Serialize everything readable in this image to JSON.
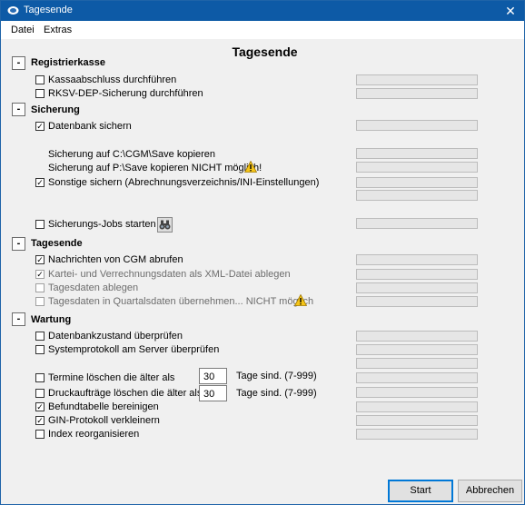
{
  "window": {
    "title": "Tagesende",
    "close_glyph": "✕",
    "app_icon": "cgm-app-icon"
  },
  "menu": {
    "items": [
      "Datei",
      "Extras"
    ]
  },
  "page": {
    "title": "Tagesende"
  },
  "icons": {
    "collapse_glyph": "-",
    "check_glyph": "✓",
    "warning_icon": "warning-triangle-icon",
    "find_icon": "binoculars-icon"
  },
  "sections": {
    "registrierkasse": {
      "title": "Registrierkasse",
      "items": [
        "Kassaabschluss durchführen",
        "RKSV-DEP-Sicherung durchführen"
      ]
    },
    "sicherung": {
      "title": "Sicherung",
      "datenbank": "Datenbank sichern",
      "copy_c": "Sicherung auf C:\\CGM\\Save kopieren",
      "copy_p": "Sicherung auf P:\\Save kopieren NICHT möglich!",
      "sonstige": "Sonstige sichern (Abrechnungsverzeichnis/INI-Einstellungen)",
      "jobs": "Sicherungs-Jobs starten"
    },
    "tagesende": {
      "title": "Tagesende",
      "items": [
        "Nachrichten von CGM abrufen",
        "Kartei- und Verrechnungsdaten als XML-Datei ablegen",
        "Tagesdaten ablegen",
        "Tagesdaten in Quartalsdaten übernehmen... NICHT möglich"
      ]
    },
    "wartung": {
      "title": "Wartung",
      "items": [
        "Datenbankzustand überprüfen",
        "Systemprotokoll am Server überprüfen",
        "Termine löschen die älter als",
        "Druckaufträge löschen die älter als",
        "Befundtabelle bereinigen",
        "GIN-Protokoll verkleinern",
        "Index reorganisieren"
      ],
      "termine_days": "30",
      "druck_days": "30",
      "days_suffix": "Tage sind. (7-999)"
    }
  },
  "buttons": {
    "start": "Start",
    "cancel": "Abbrechen"
  }
}
